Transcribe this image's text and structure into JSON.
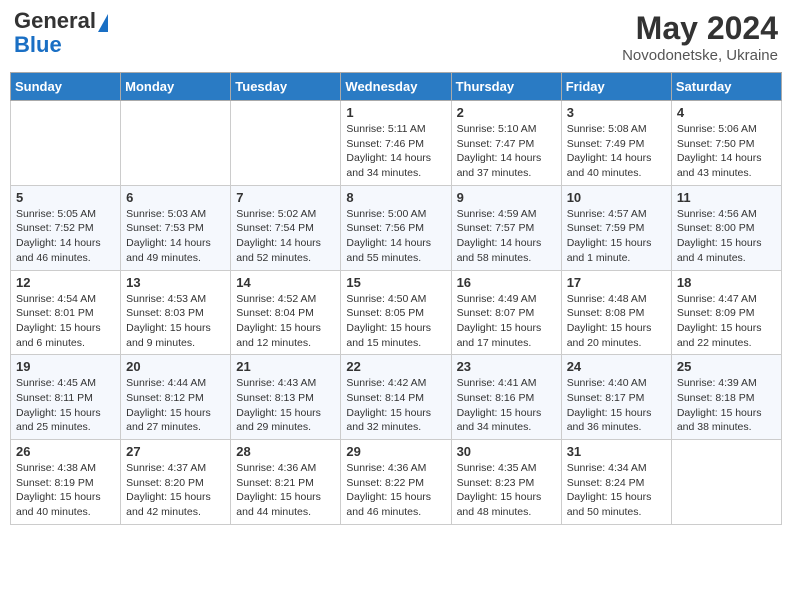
{
  "logo": {
    "general": "General",
    "blue": "Blue"
  },
  "title": "May 2024",
  "location": "Novodonetske, Ukraine",
  "days_of_week": [
    "Sunday",
    "Monday",
    "Tuesday",
    "Wednesday",
    "Thursday",
    "Friday",
    "Saturday"
  ],
  "weeks": [
    [
      {
        "day": "",
        "sunrise": "",
        "sunset": "",
        "daylight": ""
      },
      {
        "day": "",
        "sunrise": "",
        "sunset": "",
        "daylight": ""
      },
      {
        "day": "",
        "sunrise": "",
        "sunset": "",
        "daylight": ""
      },
      {
        "day": "1",
        "sunrise": "Sunrise: 5:11 AM",
        "sunset": "Sunset: 7:46 PM",
        "daylight": "Daylight: 14 hours and 34 minutes."
      },
      {
        "day": "2",
        "sunrise": "Sunrise: 5:10 AM",
        "sunset": "Sunset: 7:47 PM",
        "daylight": "Daylight: 14 hours and 37 minutes."
      },
      {
        "day": "3",
        "sunrise": "Sunrise: 5:08 AM",
        "sunset": "Sunset: 7:49 PM",
        "daylight": "Daylight: 14 hours and 40 minutes."
      },
      {
        "day": "4",
        "sunrise": "Sunrise: 5:06 AM",
        "sunset": "Sunset: 7:50 PM",
        "daylight": "Daylight: 14 hours and 43 minutes."
      }
    ],
    [
      {
        "day": "5",
        "sunrise": "Sunrise: 5:05 AM",
        "sunset": "Sunset: 7:52 PM",
        "daylight": "Daylight: 14 hours and 46 minutes."
      },
      {
        "day": "6",
        "sunrise": "Sunrise: 5:03 AM",
        "sunset": "Sunset: 7:53 PM",
        "daylight": "Daylight: 14 hours and 49 minutes."
      },
      {
        "day": "7",
        "sunrise": "Sunrise: 5:02 AM",
        "sunset": "Sunset: 7:54 PM",
        "daylight": "Daylight: 14 hours and 52 minutes."
      },
      {
        "day": "8",
        "sunrise": "Sunrise: 5:00 AM",
        "sunset": "Sunset: 7:56 PM",
        "daylight": "Daylight: 14 hours and 55 minutes."
      },
      {
        "day": "9",
        "sunrise": "Sunrise: 4:59 AM",
        "sunset": "Sunset: 7:57 PM",
        "daylight": "Daylight: 14 hours and 58 minutes."
      },
      {
        "day": "10",
        "sunrise": "Sunrise: 4:57 AM",
        "sunset": "Sunset: 7:59 PM",
        "daylight": "Daylight: 15 hours and 1 minute."
      },
      {
        "day": "11",
        "sunrise": "Sunrise: 4:56 AM",
        "sunset": "Sunset: 8:00 PM",
        "daylight": "Daylight: 15 hours and 4 minutes."
      }
    ],
    [
      {
        "day": "12",
        "sunrise": "Sunrise: 4:54 AM",
        "sunset": "Sunset: 8:01 PM",
        "daylight": "Daylight: 15 hours and 6 minutes."
      },
      {
        "day": "13",
        "sunrise": "Sunrise: 4:53 AM",
        "sunset": "Sunset: 8:03 PM",
        "daylight": "Daylight: 15 hours and 9 minutes."
      },
      {
        "day": "14",
        "sunrise": "Sunrise: 4:52 AM",
        "sunset": "Sunset: 8:04 PM",
        "daylight": "Daylight: 15 hours and 12 minutes."
      },
      {
        "day": "15",
        "sunrise": "Sunrise: 4:50 AM",
        "sunset": "Sunset: 8:05 PM",
        "daylight": "Daylight: 15 hours and 15 minutes."
      },
      {
        "day": "16",
        "sunrise": "Sunrise: 4:49 AM",
        "sunset": "Sunset: 8:07 PM",
        "daylight": "Daylight: 15 hours and 17 minutes."
      },
      {
        "day": "17",
        "sunrise": "Sunrise: 4:48 AM",
        "sunset": "Sunset: 8:08 PM",
        "daylight": "Daylight: 15 hours and 20 minutes."
      },
      {
        "day": "18",
        "sunrise": "Sunrise: 4:47 AM",
        "sunset": "Sunset: 8:09 PM",
        "daylight": "Daylight: 15 hours and 22 minutes."
      }
    ],
    [
      {
        "day": "19",
        "sunrise": "Sunrise: 4:45 AM",
        "sunset": "Sunset: 8:11 PM",
        "daylight": "Daylight: 15 hours and 25 minutes."
      },
      {
        "day": "20",
        "sunrise": "Sunrise: 4:44 AM",
        "sunset": "Sunset: 8:12 PM",
        "daylight": "Daylight: 15 hours and 27 minutes."
      },
      {
        "day": "21",
        "sunrise": "Sunrise: 4:43 AM",
        "sunset": "Sunset: 8:13 PM",
        "daylight": "Daylight: 15 hours and 29 minutes."
      },
      {
        "day": "22",
        "sunrise": "Sunrise: 4:42 AM",
        "sunset": "Sunset: 8:14 PM",
        "daylight": "Daylight: 15 hours and 32 minutes."
      },
      {
        "day": "23",
        "sunrise": "Sunrise: 4:41 AM",
        "sunset": "Sunset: 8:16 PM",
        "daylight": "Daylight: 15 hours and 34 minutes."
      },
      {
        "day": "24",
        "sunrise": "Sunrise: 4:40 AM",
        "sunset": "Sunset: 8:17 PM",
        "daylight": "Daylight: 15 hours and 36 minutes."
      },
      {
        "day": "25",
        "sunrise": "Sunrise: 4:39 AM",
        "sunset": "Sunset: 8:18 PM",
        "daylight": "Daylight: 15 hours and 38 minutes."
      }
    ],
    [
      {
        "day": "26",
        "sunrise": "Sunrise: 4:38 AM",
        "sunset": "Sunset: 8:19 PM",
        "daylight": "Daylight: 15 hours and 40 minutes."
      },
      {
        "day": "27",
        "sunrise": "Sunrise: 4:37 AM",
        "sunset": "Sunset: 8:20 PM",
        "daylight": "Daylight: 15 hours and 42 minutes."
      },
      {
        "day": "28",
        "sunrise": "Sunrise: 4:36 AM",
        "sunset": "Sunset: 8:21 PM",
        "daylight": "Daylight: 15 hours and 44 minutes."
      },
      {
        "day": "29",
        "sunrise": "Sunrise: 4:36 AM",
        "sunset": "Sunset: 8:22 PM",
        "daylight": "Daylight: 15 hours and 46 minutes."
      },
      {
        "day": "30",
        "sunrise": "Sunrise: 4:35 AM",
        "sunset": "Sunset: 8:23 PM",
        "daylight": "Daylight: 15 hours and 48 minutes."
      },
      {
        "day": "31",
        "sunrise": "Sunrise: 4:34 AM",
        "sunset": "Sunset: 8:24 PM",
        "daylight": "Daylight: 15 hours and 50 minutes."
      },
      {
        "day": "",
        "sunrise": "",
        "sunset": "",
        "daylight": ""
      }
    ]
  ]
}
